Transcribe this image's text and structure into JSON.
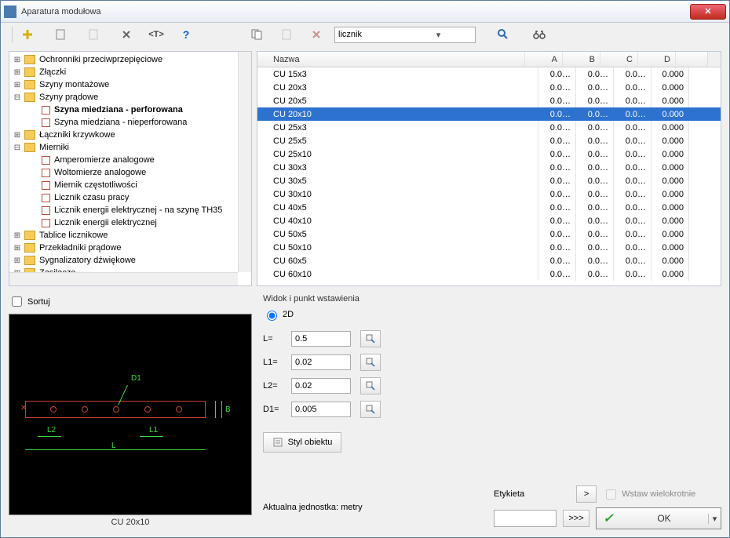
{
  "window": {
    "title": "Aparatura modułowa"
  },
  "toolbar": {
    "search_value": "licznik"
  },
  "tree": {
    "items": [
      {
        "indent": 0,
        "exp": "+",
        "icon": "folder",
        "label": "Ochronniki przeciwprzepięciowe"
      },
      {
        "indent": 0,
        "exp": "+",
        "icon": "folder",
        "label": "Złączki"
      },
      {
        "indent": 0,
        "exp": "+",
        "icon": "folder",
        "label": "Szyny montażowe"
      },
      {
        "indent": 0,
        "exp": "-",
        "icon": "folder",
        "label": "Szyny prądowe"
      },
      {
        "indent": 1,
        "exp": "",
        "icon": "doc",
        "label": "Szyna miedziana - perforowana",
        "bold": true
      },
      {
        "indent": 1,
        "exp": "",
        "icon": "doc",
        "label": "Szyna miedziana - nieperforowana"
      },
      {
        "indent": 0,
        "exp": "+",
        "icon": "folder",
        "label": "Łączniki krzywkowe"
      },
      {
        "indent": 0,
        "exp": "-",
        "icon": "folder",
        "label": "Mierniki"
      },
      {
        "indent": 1,
        "exp": "",
        "icon": "doc",
        "label": "Amperomierze analogowe"
      },
      {
        "indent": 1,
        "exp": "",
        "icon": "doc",
        "label": "Woltomierze analogowe"
      },
      {
        "indent": 1,
        "exp": "",
        "icon": "doc",
        "label": "Miernik częstotliwości"
      },
      {
        "indent": 1,
        "exp": "",
        "icon": "doc",
        "label": "Licznik czasu pracy"
      },
      {
        "indent": 1,
        "exp": "",
        "icon": "doc",
        "label": "Licznik energii elektrycznej - na szynę TH35"
      },
      {
        "indent": 1,
        "exp": "",
        "icon": "doc",
        "label": "Licznik energii elektrycznej"
      },
      {
        "indent": 0,
        "exp": "+",
        "icon": "folder",
        "label": "Tablice licznikowe"
      },
      {
        "indent": 0,
        "exp": "+",
        "icon": "folder",
        "label": "Przekładniki prądowe"
      },
      {
        "indent": 0,
        "exp": "+",
        "icon": "folder",
        "label": "Sygnalizatory dźwiękowe"
      },
      {
        "indent": 0,
        "exp": "+",
        "icon": "folder",
        "label": "Zasilacze"
      }
    ]
  },
  "sortuj_label": "Sortuj",
  "preview_caption": "CU 20x10",
  "preview_labels": {
    "d1": "D1",
    "b": "B",
    "l": "L",
    "l1": "L1",
    "l2": "L2"
  },
  "table": {
    "headers": {
      "name": "Nazwa",
      "a": "A",
      "b": "B",
      "c": "C",
      "d": "D"
    },
    "selected_index": 3,
    "rows": [
      {
        "name": "CU 15x3",
        "a": "0.0…",
        "b": "0.0…",
        "c": "0.0…",
        "d": "0.000"
      },
      {
        "name": "CU 20x3",
        "a": "0.0…",
        "b": "0.0…",
        "c": "0.0…",
        "d": "0.000"
      },
      {
        "name": "CU 20x5",
        "a": "0.0…",
        "b": "0.0…",
        "c": "0.0…",
        "d": "0.000"
      },
      {
        "name": "CU 20x10",
        "a": "0.0…",
        "b": "0.0…",
        "c": "0.0…",
        "d": "0.000"
      },
      {
        "name": "CU 25x3",
        "a": "0.0…",
        "b": "0.0…",
        "c": "0.0…",
        "d": "0.000"
      },
      {
        "name": "CU 25x5",
        "a": "0.0…",
        "b": "0.0…",
        "c": "0.0…",
        "d": "0.000"
      },
      {
        "name": "CU 25x10",
        "a": "0.0…",
        "b": "0.0…",
        "c": "0.0…",
        "d": "0.000"
      },
      {
        "name": "CU 30x3",
        "a": "0.0…",
        "b": "0.0…",
        "c": "0.0…",
        "d": "0.000"
      },
      {
        "name": "CU 30x5",
        "a": "0.0…",
        "b": "0.0…",
        "c": "0.0…",
        "d": "0.000"
      },
      {
        "name": "CU 30x10",
        "a": "0.0…",
        "b": "0.0…",
        "c": "0.0…",
        "d": "0.000"
      },
      {
        "name": "CU 40x5",
        "a": "0.0…",
        "b": "0.0…",
        "c": "0.0…",
        "d": "0.000"
      },
      {
        "name": "CU 40x10",
        "a": "0.0…",
        "b": "0.0…",
        "c": "0.0…",
        "d": "0.000"
      },
      {
        "name": "CU 50x5",
        "a": "0.0…",
        "b": "0.0…",
        "c": "0.0…",
        "d": "0.000"
      },
      {
        "name": "CU 50x10",
        "a": "0.0…",
        "b": "0.0…",
        "c": "0.0…",
        "d": "0.000"
      },
      {
        "name": "CU 60x5",
        "a": "0.0…",
        "b": "0.0…",
        "c": "0.0…",
        "d": "0.000"
      },
      {
        "name": "CU 60x10",
        "a": "0.0…",
        "b": "0.0…",
        "c": "0.0…",
        "d": "0.000"
      }
    ]
  },
  "section": {
    "widok": "Widok i punkt wstawienia",
    "mode2d": "2D"
  },
  "params": {
    "L": {
      "label": "L=",
      "value": "0.5"
    },
    "L1": {
      "label": "L1=",
      "value": "0.02"
    },
    "L2": {
      "label": "L2=",
      "value": "0.02"
    },
    "D1": {
      "label": "D1=",
      "value": "0.005"
    }
  },
  "styl_label": "Styl obiektu",
  "etykieta_label": "Etykieta",
  "wstaw_label": "Wstaw wielokrotnie",
  "unit_label": "Aktualna jednostka: metry",
  "gt": ">",
  "gtgt": ">>>",
  "ok_label": "OK"
}
